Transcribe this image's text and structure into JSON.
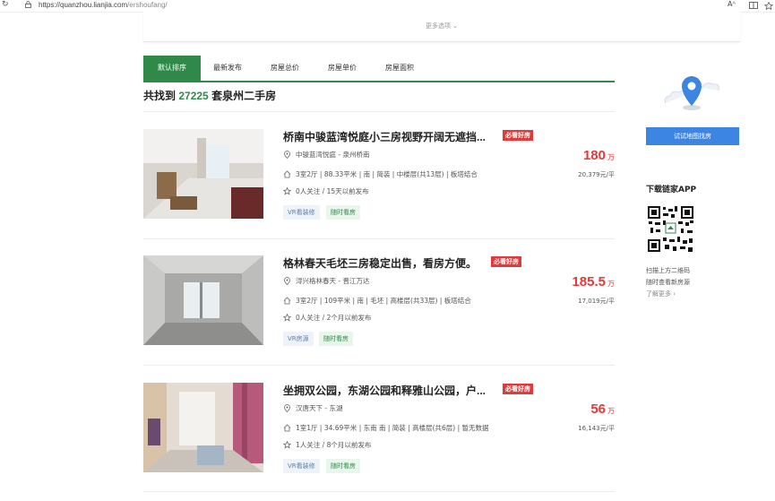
{
  "browser": {
    "url_host": "https://quanzhou.lianjia.com",
    "url_path": "/ershoufang/",
    "reader_label": "Aᴬ"
  },
  "filters": {
    "more_options": "更多选项 ⌄"
  },
  "sort_tabs": [
    {
      "label": "默认排序",
      "active": true
    },
    {
      "label": "最新发布",
      "active": false
    },
    {
      "label": "房屋总价",
      "active": false
    },
    {
      "label": "房屋单价",
      "active": false
    },
    {
      "label": "房屋面积",
      "active": false
    }
  ],
  "results": {
    "prefix": "共找到",
    "count": "27225",
    "suffix": "套泉州二手房"
  },
  "listings": [
    {
      "title": "桥南中骏蓝湾悦庭小三房视野开阔无遮挡...",
      "badge": "必看好房",
      "location": "中骏蓝湾悦庭 - 泉州桥南",
      "details": "3室2厅 | 88.33平米 | 南 | 简装 | 中楼层(共13层) | 板塔结合",
      "follow": "0人关注 / 15天以前发布",
      "tags": [
        "VR看装修",
        "随时看房"
      ],
      "price": "180",
      "price_unit": "万",
      "unit_price": "20,379元/平"
    },
    {
      "title": "格林春天毛坯三房稳定出售，看房方便。",
      "badge": "必看好房",
      "location": "浔兴格林春天 - 晋江万达",
      "details": "3室2厅 | 109平米 | 南 | 毛坯 | 高楼层(共33层) | 板塔结合",
      "follow": "0人关注 / 2个月以前发布",
      "tags": [
        "VR房源",
        "随时看房"
      ],
      "price": "185.5",
      "price_unit": "万",
      "unit_price": "17,019元/平"
    },
    {
      "title": "坐拥双公园，东湖公园和释雅山公园，户...",
      "badge": "必看好房",
      "location": "汉唐天下 - 东湖",
      "details": "1室1厅 | 34.69平米 | 东南 南 | 简装 | 高楼层(共6层) | 暂无数据",
      "follow": "1人关注 / 8个月以前发布",
      "tags": [
        "VR看装修",
        "随时看房"
      ],
      "price": "56",
      "price_unit": "万",
      "unit_price": "16,143元/平"
    }
  ],
  "sidebar": {
    "map_button": "试试地图找房",
    "app_heading": "下载链家APP",
    "scan_line1": "扫描上方二维码",
    "scan_line2": "随时查看新房源",
    "learn_more": "了解更多 ›"
  },
  "colors": {
    "accent_green": "#2f8a4a",
    "price_red": "#e03a3a",
    "map_blue": "#3d85e3"
  }
}
